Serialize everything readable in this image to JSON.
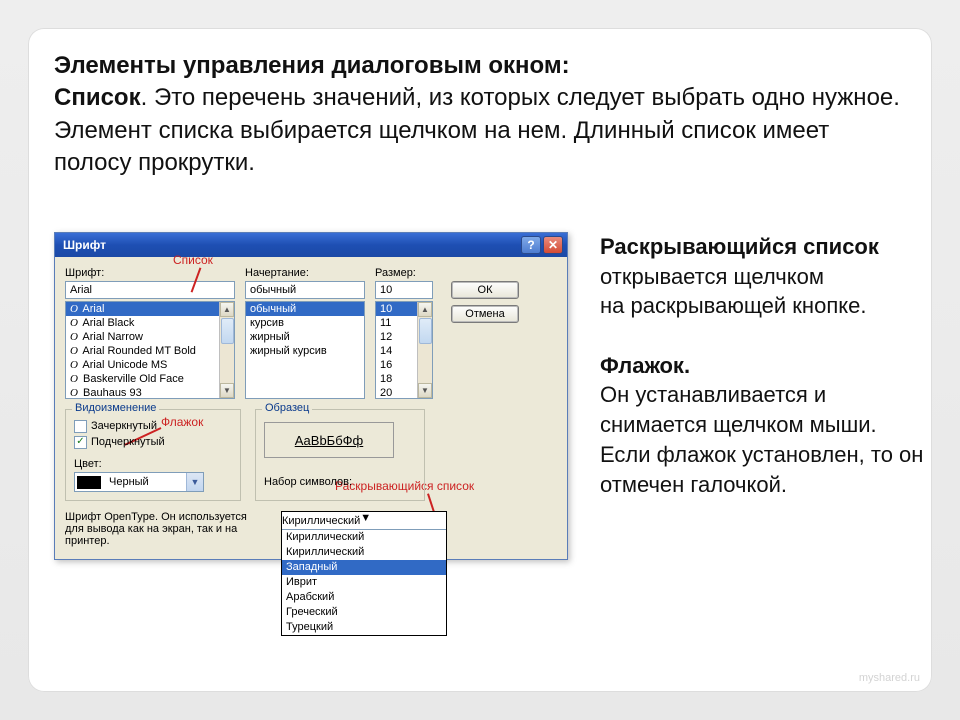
{
  "heading": {
    "title": "Элементы управления диалоговым окном:",
    "lead": "Список",
    "body": ". Это перечень значений, из которых следует выбрать одно нужное. Элемент списка выбирается щелчком на нем. Длинный список имеет полосу прокрутки."
  },
  "side": {
    "p1_lead": "Раскрывающийся список",
    "p1_rest": " открывается щелчком",
    "p1_line2": " на раскрывающей кнопке.",
    "p2_lead": "Флажок.",
    "p2_body": "Он устанавливается и снимается щелчком мыши. Если флажок установлен, то он отмечен галочкой."
  },
  "dialog": {
    "title": "Шрифт",
    "labels": {
      "font": "Шрифт:",
      "style": "Начертание:",
      "size": "Размер:",
      "modif_group": "Видоизменение",
      "sample_group": "Образец",
      "color": "Цвет:",
      "charset": "Набор символов:"
    },
    "values": {
      "font": "Arial",
      "style": "обычный",
      "size": "10",
      "color": "Черный",
      "charset_selected": "Кириллический",
      "sample": "АаВbБбФф"
    },
    "font_list": [
      "Arial",
      "Arial Black",
      "Arial Narrow",
      "Arial Rounded MT Bold",
      "Arial Unicode MS",
      "Baskerville Old Face",
      "Bauhaus 93"
    ],
    "style_list": [
      "обычный",
      "курсив",
      "жирный",
      "жирный курсив"
    ],
    "size_list": [
      "10",
      "11",
      "12",
      "14",
      "16",
      "18",
      "20"
    ],
    "charset_list": [
      "Кириллический",
      "Кириллический",
      "Западный",
      "Иврит",
      "Арабский",
      "Греческий",
      "Турецкий"
    ],
    "checks": {
      "strike": "Зачеркнутый",
      "underline": "Подчеркнутый"
    },
    "buttons": {
      "ok": "ОК",
      "cancel": "Отмена"
    },
    "hint": "Шрифт OpenType. Он используется для вывода как на экран, так и на принтер."
  },
  "annotations": {
    "list": "Список",
    "checkbox": "Флажок",
    "dropdown": "Раскрывающийся список"
  },
  "watermark": "myshared.ru"
}
